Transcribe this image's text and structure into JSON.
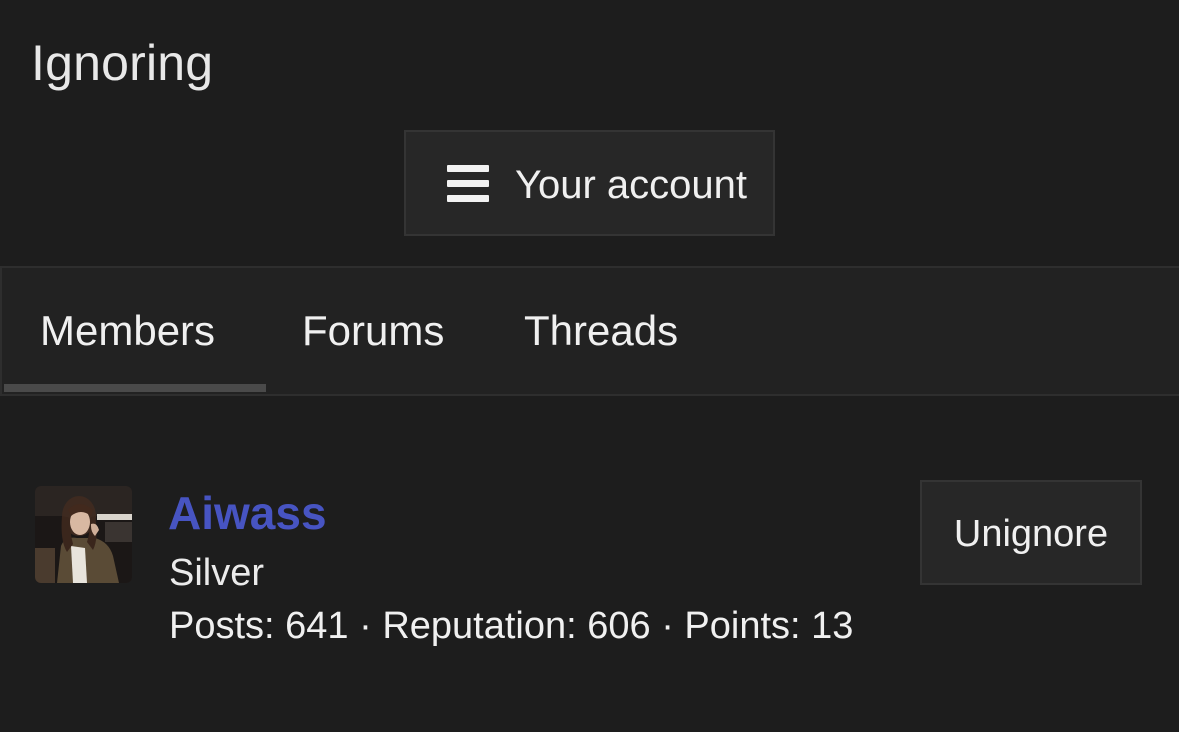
{
  "page": {
    "title": "Ignoring"
  },
  "account_button": {
    "icon": "menu-icon",
    "label": "Your account"
  },
  "tabs": [
    {
      "label": "Members",
      "active": true
    },
    {
      "label": "Forums",
      "active": false
    },
    {
      "label": "Threads",
      "active": false
    }
  ],
  "members": [
    {
      "name": "Aiwass",
      "rank": "Silver",
      "stats": "Posts: 641 · Reputation: 606 · Points: 13",
      "action_label": "Unignore"
    }
  ],
  "colors": {
    "background": "#1d1d1d",
    "username_link": "#4754c2",
    "button_bg": "#272727",
    "text": "#f0f0f0"
  }
}
